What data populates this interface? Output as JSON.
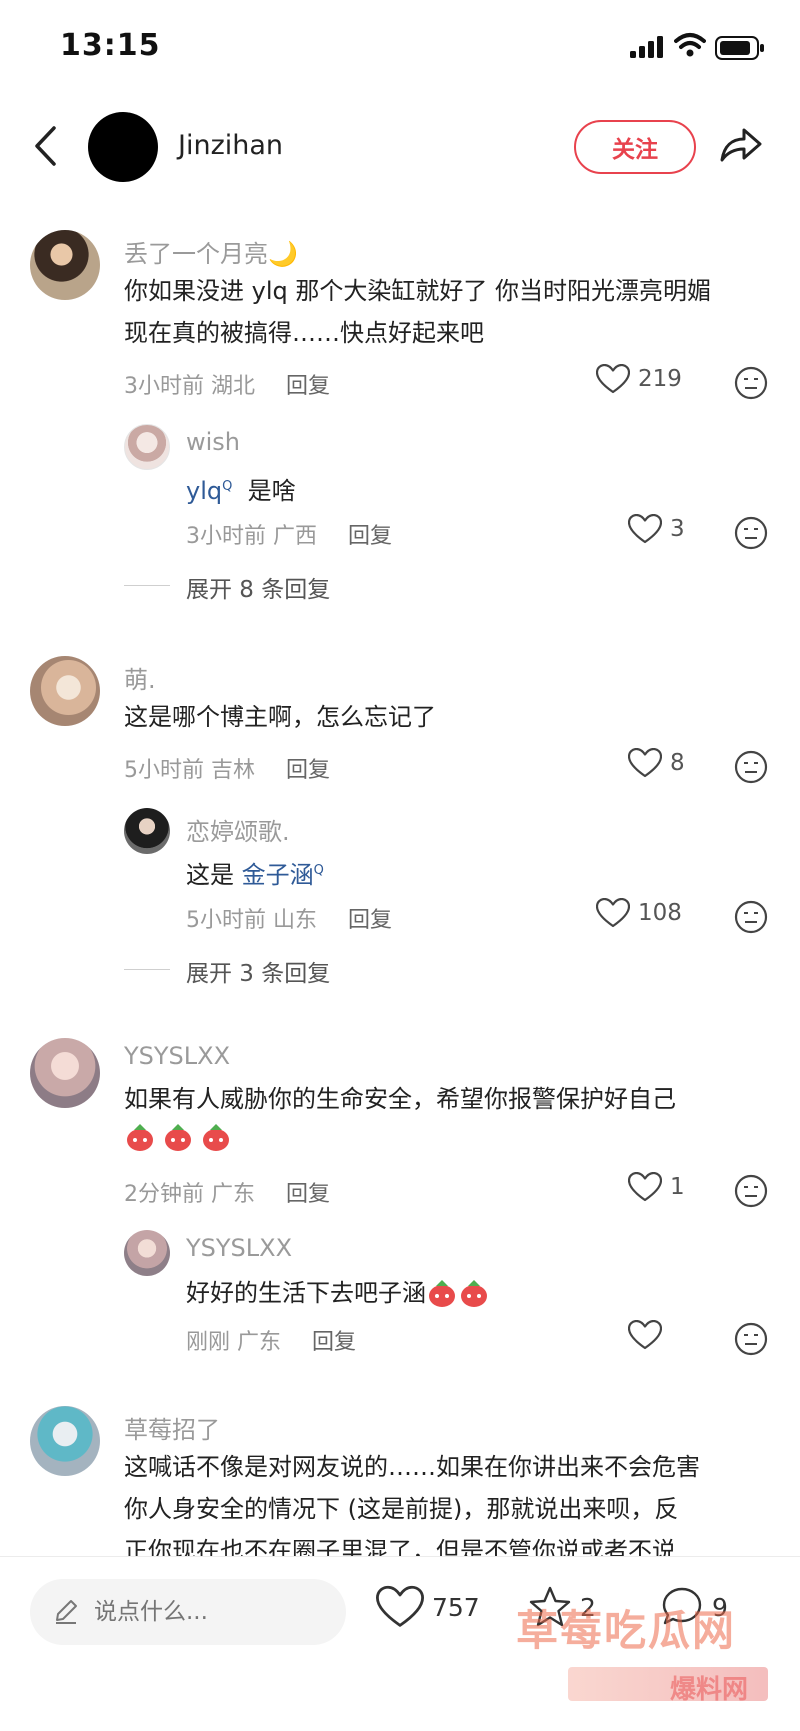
{
  "status_bar": {
    "time": "13:15"
  },
  "header": {
    "username": "Jinzihan",
    "follow_label": "关注"
  },
  "comments": [
    {
      "username": "丢了一个月亮🌙",
      "text_lines": [
        "你如果没进 ylq 那个大染缸就好了 你当时阳光漂亮明媚",
        "现在真的被搞得……快点好起来吧"
      ],
      "time": "3小时前",
      "location": "湖北",
      "reply_label": "回复",
      "likes": "219",
      "sub_reply": {
        "username": "wish",
        "mention": "ylq",
        "text": "是啥",
        "time": "3小时前",
        "location": "广西",
        "reply_label": "回复",
        "likes": "3"
      },
      "expand_label": "展开 8 条回复"
    },
    {
      "username": "萌.",
      "text_lines": [
        "这是哪个博主啊，怎么忘记了"
      ],
      "time": "5小时前",
      "location": "吉林",
      "reply_label": "回复",
      "likes": "8",
      "sub_reply": {
        "username": "恋婷颂歌.",
        "prefix": "这是",
        "mention": "金子涵",
        "time": "5小时前",
        "location": "山东",
        "reply_label": "回复",
        "likes": "108"
      },
      "expand_label": "展开 3 条回复"
    },
    {
      "username": "YSYSLXX",
      "text_lines": [
        "如果有人威胁你的生命安全，希望你报警保护好自己"
      ],
      "time": "2分钟前",
      "location": "广东",
      "reply_label": "回复",
      "likes": "1",
      "sub_reply": {
        "username": "YSYSLXX",
        "text": "好好的生活下去吧子涵",
        "time": "刚刚",
        "location": "广东",
        "reply_label": "回复",
        "likes": ""
      }
    },
    {
      "username": "草莓招了",
      "text_lines": [
        "这喊话不像是对网友说的……如果在你讲出来不会危害",
        "你人身安全的情况下 (这是前提)，那就说出来呗，反",
        "正你现在也不在圈子里混了，但是不管你说或者不说"
      ]
    }
  ],
  "bottom_bar": {
    "input_placeholder": "说点什么...",
    "like_count": "757",
    "star_count": "2",
    "comment_count": "9"
  },
  "watermark": {
    "line1": "草莓吃瓜网",
    "line2": "爆料网"
  },
  "colors": {
    "accent": "#e8424d",
    "mention": "#2f5a97"
  }
}
